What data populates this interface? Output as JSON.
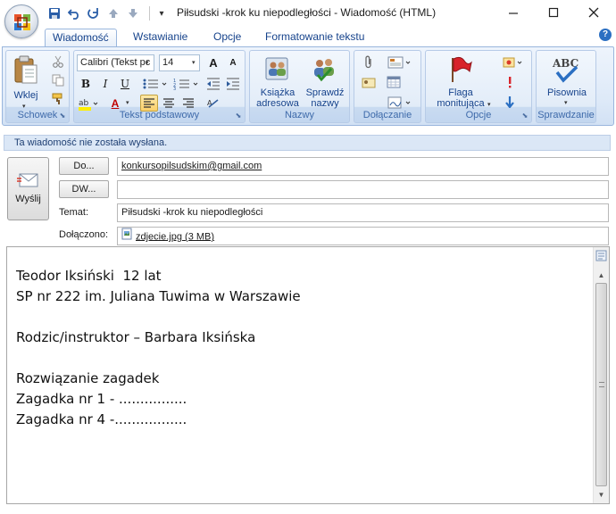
{
  "window": {
    "title": "Piłsudski -krok ku niepodległości - Wiadomość (HTML)"
  },
  "quick_access": {
    "qat_dropdown_glyph": "▾"
  },
  "tabs": [
    {
      "label": "Wiadomość",
      "active": true
    },
    {
      "label": "Wstawianie",
      "active": false
    },
    {
      "label": "Opcje",
      "active": false
    },
    {
      "label": "Formatowanie tekstu",
      "active": false
    }
  ],
  "ribbon": {
    "clipboard": {
      "label": "Schowek",
      "paste_label": "Wklej"
    },
    "basic_text": {
      "label": "Tekst podstawowy",
      "font_name": "Calibri (Tekst pc",
      "font_size": "14",
      "bold": "B",
      "italic": "I",
      "underline": "U",
      "grow_font": "A",
      "shrink_font": "A",
      "font_color": "A"
    },
    "names": {
      "label": "Nazwy",
      "address_book_line1": "Książka",
      "address_book_line2": "adresowa",
      "check_names_line1": "Sprawdź",
      "check_names_line2": "nazwy"
    },
    "include": {
      "label": "Dołączanie"
    },
    "options": {
      "label": "Opcje",
      "follow_up_line1": "Flaga",
      "follow_up_line2": "monitująca"
    },
    "proofing": {
      "label": "Sprawdzanie",
      "spelling_label": "Pisownia",
      "abc": "ABC"
    }
  },
  "infobar": {
    "text": "Ta wiadomość nie została wysłana."
  },
  "header": {
    "send_label": "Wyślij",
    "to_button": "Do...",
    "cc_button": "DW...",
    "subject_label": "Temat:",
    "attached_label": "Dołączono:",
    "to_value": "konkursopilsudskim@gmail.com",
    "cc_value": "",
    "subject_value": "Piłsudski -krok ku niepodległości",
    "attachment_name": "zdjecie.jpg (3 MB)"
  },
  "body": {
    "lines": [
      "Teodor Iksiński  12 lat",
      "SP nr 222 im. Juliana Tuwima w Warszawie",
      "",
      "Rodzic/instruktor – Barbara Iksińska",
      "",
      "Rozwiązanie zagadek",
      "Zagadka nr 1 - ................",
      "Zagadka nr 4 -................."
    ]
  },
  "colors": {
    "ribbon_text": "#15428b",
    "group_label": "#3e6aaa",
    "infobar_bg": "#dbe7f6"
  }
}
